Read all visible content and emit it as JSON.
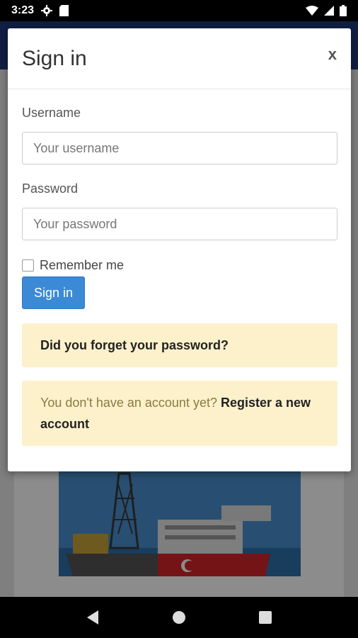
{
  "status_bar": {
    "time": "3:23",
    "icons": [
      "gear-icon",
      "sd-card-icon",
      "wifi-icon",
      "signal-icon",
      "battery-icon"
    ]
  },
  "modal": {
    "title": "Sign in",
    "close_label": "x",
    "username": {
      "label": "Username",
      "placeholder": "Your username",
      "value": ""
    },
    "password": {
      "label": "Password",
      "placeholder": "Your password",
      "value": ""
    },
    "remember": {
      "label": "Remember me",
      "checked": false
    },
    "submit_label": "Sign in",
    "forgot_link": "Did you forget your password?",
    "register": {
      "prompt": "You don't have an account yet?",
      "link": "Register a new account"
    }
  },
  "colors": {
    "primary_button": "#3c8ad6",
    "notice_bg": "#fdf1cc",
    "navbar_bg": "#1e3a7a"
  },
  "nav_bar": {
    "icons": [
      "back-icon",
      "home-icon",
      "recents-icon"
    ]
  }
}
